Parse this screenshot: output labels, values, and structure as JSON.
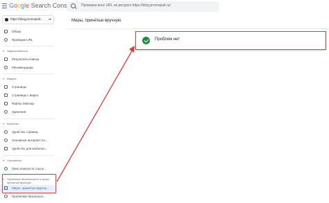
{
  "app": {
    "logo_parts": [
      "G",
      "o",
      "o",
      "g",
      "l",
      "e"
    ],
    "logo_rest": " Search Console"
  },
  "search": {
    "placeholder": "Проверка всех URL на ресурсе https://blog.promopult.ru/"
  },
  "property": {
    "label": "https://blog.promopult..."
  },
  "sidebar": {
    "overview": "Обзор",
    "url_inspection": "Проверка URL",
    "section_performance": "Эффективность",
    "search_results": "Результаты поиска",
    "discover": "Рекомендации",
    "section_index": "Индекс",
    "pages": "Страницы",
    "video_pages": "Страницы с видео",
    "sitemaps": "Файлы Sitemap",
    "removals": "Удаления",
    "section_experience": "Качество",
    "page_experience": "Удобство страниц",
    "core_web_vitals": "Основные интернет-по...",
    "mobile_usability": "Удобство для мобильн...",
    "section_enhancements": "Улучшения",
    "sitelinks_searchbox": "Окно поиска по ссылк...",
    "section_security": "Проблемы безопасности и меры, принятые вручную",
    "manual_actions": "Меры, принятые вручну...",
    "security_issues": "Проблемы безопасно..."
  },
  "main": {
    "page_title": "Меры, принятые вручную",
    "status_text": "Проблем нет"
  },
  "colors": {
    "accent": "#1967d2",
    "annotation_red": "#e53935",
    "success_green": "#1e8e3e"
  }
}
